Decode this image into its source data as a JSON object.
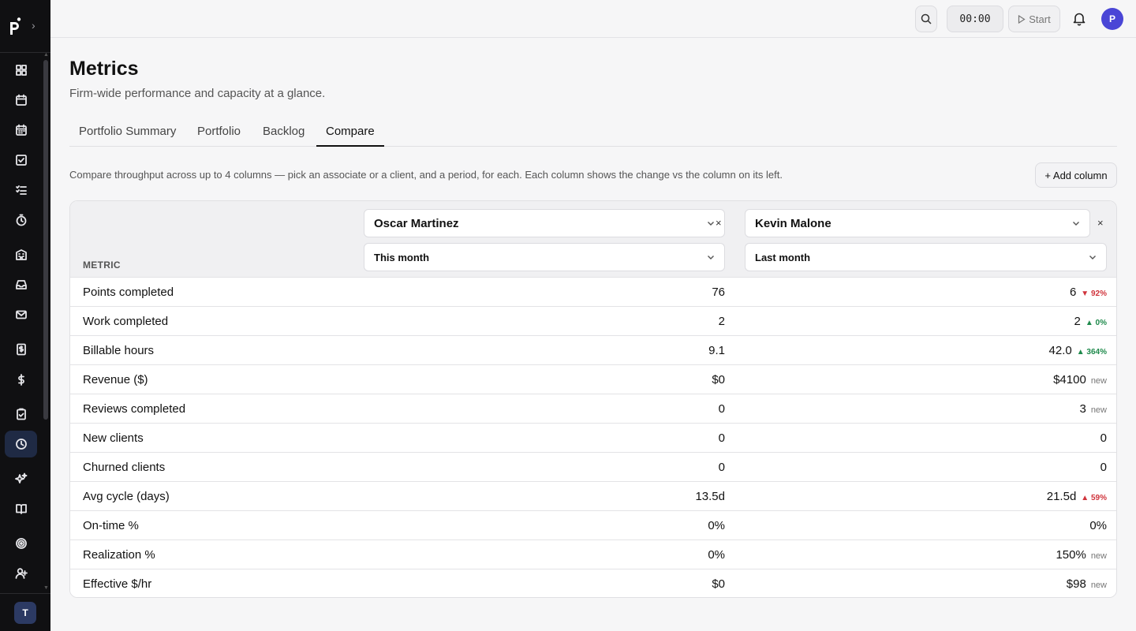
{
  "app": {
    "workspace_initial": "T",
    "user_initial": "P"
  },
  "topbar": {
    "timer": "00:00",
    "start_label": "Start"
  },
  "page": {
    "title": "Metrics",
    "subtitle": "Firm-wide performance and capacity at a glance."
  },
  "tabs": [
    {
      "label": "Portfolio Summary",
      "active": false
    },
    {
      "label": "Portfolio",
      "active": false
    },
    {
      "label": "Backlog",
      "active": false
    },
    {
      "label": "Compare",
      "active": true
    }
  ],
  "compare": {
    "hint": "Compare throughput across up to 4 columns — pick an associate or a client, and a period, for each. Each column shows the change vs the column on its left.",
    "add_column_label": "+ Add column",
    "metric_header": "METRIC",
    "columns": [
      {
        "entity": "Oscar Martinez",
        "period": "This month",
        "remove": "×"
      },
      {
        "entity": "Kevin Malone",
        "period": "Last month",
        "remove": "×"
      }
    ],
    "rows": [
      {
        "metric": "Points completed",
        "a": "76",
        "b": "6",
        "delta": "▼ 92%",
        "delta_kind": "red"
      },
      {
        "metric": "Work completed",
        "a": "2",
        "b": "2",
        "delta": "▲ 0%",
        "delta_kind": "green"
      },
      {
        "metric": "Billable hours",
        "a": "9.1",
        "b": "42.0",
        "delta": "▲ 364%",
        "delta_kind": "green"
      },
      {
        "metric": "Revenue ($)",
        "a": "$0",
        "b": "$4100",
        "delta": "new",
        "delta_kind": "new"
      },
      {
        "metric": "Reviews completed",
        "a": "0",
        "b": "3",
        "delta": "new",
        "delta_kind": "new"
      },
      {
        "metric": "New clients",
        "a": "0",
        "b": "0",
        "delta": "",
        "delta_kind": "none"
      },
      {
        "metric": "Churned clients",
        "a": "0",
        "b": "0",
        "delta": "",
        "delta_kind": "none"
      },
      {
        "metric": "Avg cycle (days)",
        "a": "13.5d",
        "b": "21.5d",
        "delta": "▲ 59%",
        "delta_kind": "red"
      },
      {
        "metric": "On-time %",
        "a": "0%",
        "b": "0%",
        "delta": "",
        "delta_kind": "none"
      },
      {
        "metric": "Realization %",
        "a": "0%",
        "b": "150%",
        "delta": "new",
        "delta_kind": "new"
      },
      {
        "metric": "Effective $/hr",
        "a": "$0",
        "b": "$98",
        "delta": "new",
        "delta_kind": "new"
      }
    ]
  },
  "sidebar": {
    "items": [
      {
        "icon": "dashboard-icon"
      },
      {
        "icon": "calendar-icon"
      },
      {
        "icon": "calendar-grid-icon"
      },
      {
        "icon": "task-check-icon"
      },
      {
        "icon": "checklist-icon"
      },
      {
        "icon": "stopwatch-icon"
      },
      {
        "icon": "building-icon"
      },
      {
        "icon": "inbox-icon"
      },
      {
        "icon": "mail-icon"
      },
      {
        "icon": "invoice-icon"
      },
      {
        "icon": "dollar-icon"
      },
      {
        "icon": "clipboard-check-icon"
      },
      {
        "icon": "clock-icon",
        "active": true
      },
      {
        "icon": "sparkles-icon"
      },
      {
        "icon": "book-icon"
      },
      {
        "icon": "target-icon"
      },
      {
        "icon": "add-user-icon"
      }
    ]
  }
}
